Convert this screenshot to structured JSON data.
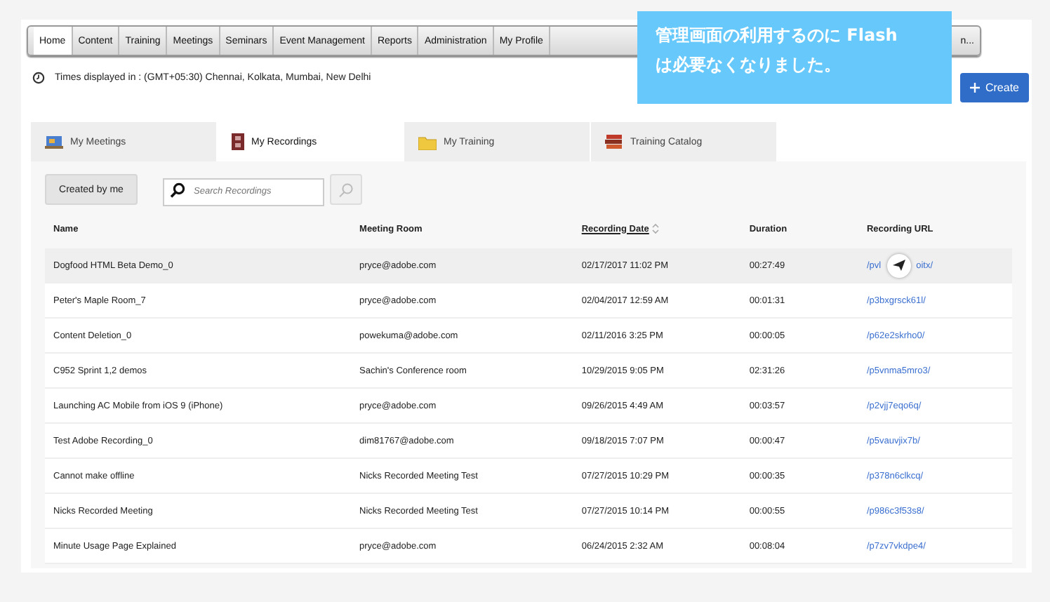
{
  "nav": [
    {
      "label": "Home",
      "selected": true
    },
    {
      "label": "Content",
      "selected": false
    },
    {
      "label": "Training",
      "selected": false
    },
    {
      "label": "Meetings",
      "selected": false
    },
    {
      "label": "Seminars",
      "selected": false
    },
    {
      "label": "Event Management",
      "selected": false
    },
    {
      "label": "Reports",
      "selected": false
    },
    {
      "label": "Administration",
      "selected": false
    },
    {
      "label": "My Profile",
      "selected": false
    }
  ],
  "nav_cut_item": "n...",
  "callout": {
    "lines": [
      "管理画面の利用するのに Flash",
      "は必要なくなりました。"
    ]
  },
  "timezone": "Times displayed in : (GMT+05:30) Chennai, Kolkata, Mumbai, New Delhi",
  "create_button": "Create",
  "tabs": [
    {
      "label": "My Meetings",
      "selected": false
    },
    {
      "label": "My Recordings",
      "selected": true
    },
    {
      "label": "My Training",
      "selected": false
    },
    {
      "label": "Training Catalog",
      "selected": false
    }
  ],
  "filter_button": "Created by me",
  "search": {
    "placeholder": "Search Recordings"
  },
  "table": {
    "columns": [
      {
        "label": "Name",
        "sortable": false
      },
      {
        "label": "Meeting Room",
        "sortable": false
      },
      {
        "label": "Recording Date",
        "sortable": true
      },
      {
        "label": "Duration",
        "sortable": false
      },
      {
        "label": "Recording URL",
        "sortable": false
      }
    ],
    "rows": [
      {
        "name": "Dogfood HTML Beta Demo_0",
        "room": "pryce@adobe.com",
        "date": "02/17/2017 11:02 PM",
        "duration": "00:27:49",
        "url_parts": [
          "/pvl",
          "oitx/"
        ],
        "selected": true
      },
      {
        "name": "Peter's Maple Room_7",
        "room": "pryce@adobe.com",
        "date": "02/04/2017 12:59 AM",
        "duration": "00:01:31",
        "url_parts": [
          "/p3bxgrsck61l/"
        ],
        "selected": false
      },
      {
        "name": "Content Deletion_0",
        "room": "powekuma@adobe.com",
        "date": "02/11/2016 3:25 PM",
        "duration": "00:00:05",
        "url_parts": [
          "/p62e2skrho0/"
        ],
        "selected": false
      },
      {
        "name": "C952 Sprint 1,2 demos",
        "room": "Sachin's Conference room",
        "date": "10/29/2015 9:05 PM",
        "duration": "02:31:26",
        "url_parts": [
          "/p5vnma5mro3/"
        ],
        "selected": false
      },
      {
        "name": "Launching AC Mobile from iOS 9 (iPhone)",
        "room": "pryce@adobe.com",
        "date": "09/26/2015 4:49 AM",
        "duration": "00:03:57",
        "url_parts": [
          "/p2vjj7eqo6q/"
        ],
        "selected": false
      },
      {
        "name": "Test Adobe Recording_0",
        "room": "dim81767@adobe.com",
        "date": "09/18/2015 7:07 PM",
        "duration": "00:00:47",
        "url_parts": [
          "/p5vauvjix7b/"
        ],
        "selected": false
      },
      {
        "name": "Cannot make offline",
        "room": "Nicks Recorded Meeting Test",
        "date": "07/27/2015 10:29 PM",
        "duration": "00:00:35",
        "url_parts": [
          "/p378n6clkcq/"
        ],
        "selected": false
      },
      {
        "name": "Nicks Recorded Meeting",
        "room": "Nicks Recorded Meeting Test",
        "date": "07/27/2015 10:14 PM",
        "duration": "00:00:55",
        "url_parts": [
          "/p986c3f53s8/"
        ],
        "selected": false
      },
      {
        "name": "Minute Usage Page Explained",
        "room": "pryce@adobe.com",
        "date": "06/24/2015 2:32 AM",
        "duration": "00:08:04",
        "url_parts": [
          "/p7zv7vkdpe4/"
        ],
        "selected": false
      }
    ]
  }
}
